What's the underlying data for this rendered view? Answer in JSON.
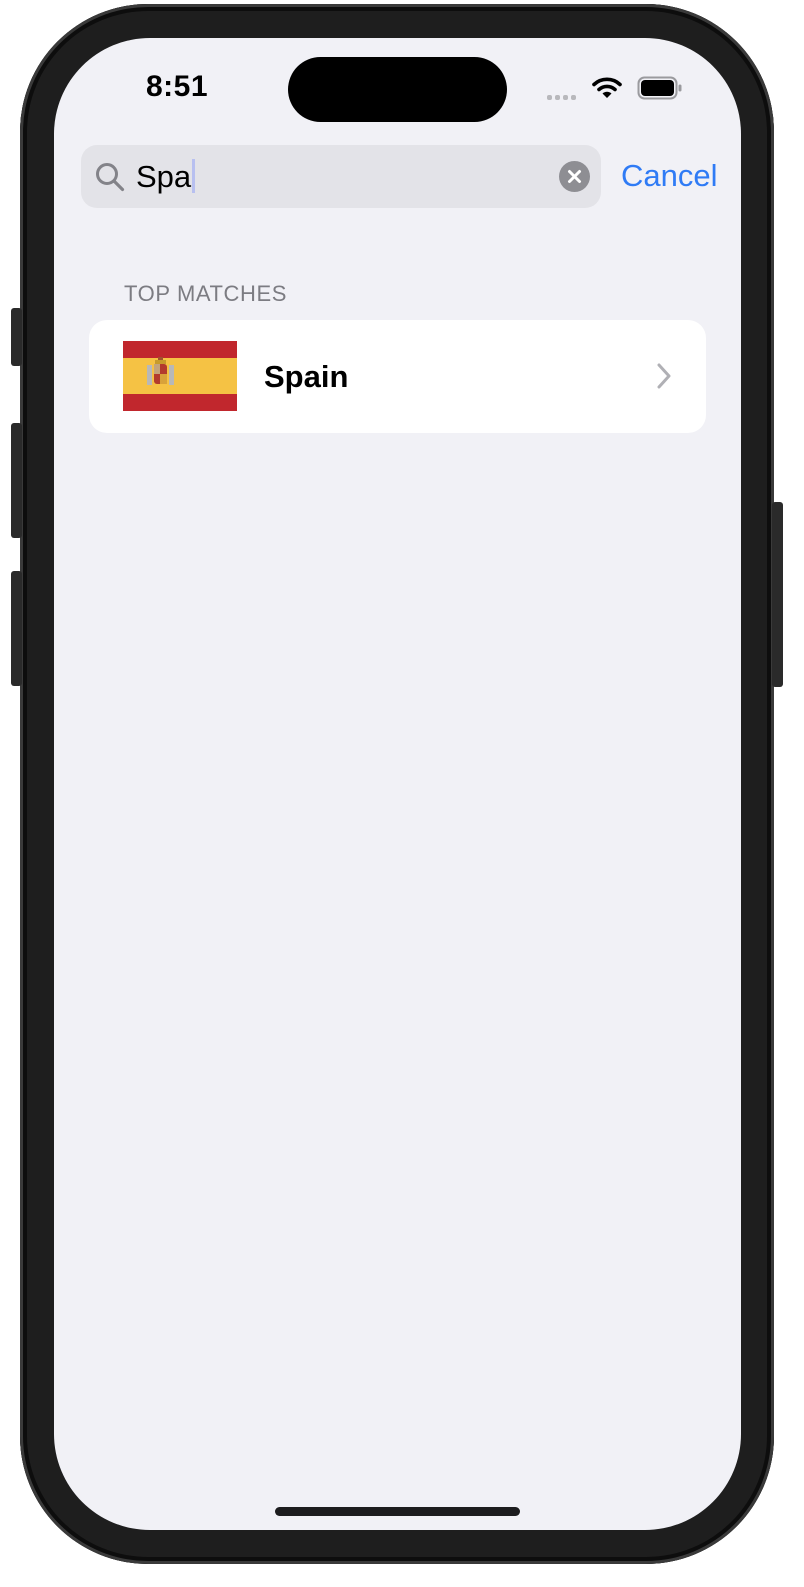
{
  "status_bar": {
    "time": "8:51",
    "icons": [
      "cellular-signal-icon",
      "wifi-icon",
      "battery-icon"
    ]
  },
  "search": {
    "query": "Spa",
    "icon": "search-icon",
    "clear_icon": "clear-icon",
    "cancel_label": "Cancel"
  },
  "results": {
    "section_title": "TOP MATCHES",
    "items": [
      {
        "label": "Spain",
        "icon": "spain-flag-icon",
        "accessory": "chevron-right-icon"
      }
    ]
  },
  "colors": {
    "accent": "#2f7bf5",
    "background": "#f1f1f6",
    "search_field": "#e3e3e8",
    "flag_red": "#c1272d",
    "flag_yellow": "#f5c244"
  }
}
